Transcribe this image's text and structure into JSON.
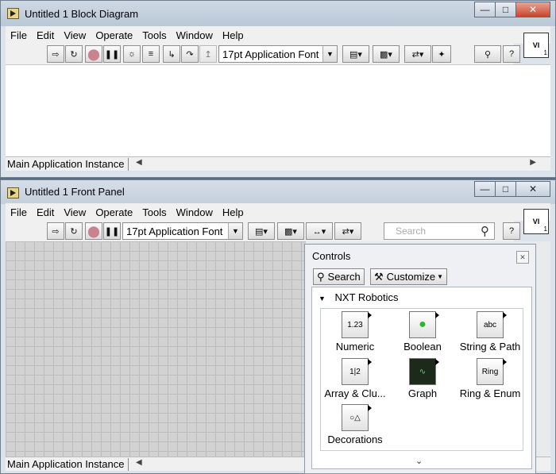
{
  "block_diagram": {
    "title": "Untitled 1 Block Diagram",
    "menu": [
      "File",
      "Edit",
      "View",
      "Operate",
      "Tools",
      "Window",
      "Help"
    ],
    "font": "17pt Application Font",
    "status": "Main Application Instance"
  },
  "front_panel": {
    "title": "Untitled 1 Front Panel",
    "menu": [
      "File",
      "Edit",
      "View",
      "Operate",
      "Tools",
      "Window",
      "Help"
    ],
    "font": "17pt Application Font",
    "search_placeholder": "Search",
    "status": "Main Application Instance"
  },
  "controls_palette": {
    "title": "Controls",
    "search_label": "Search",
    "customize_label": "Customize",
    "category": "NXT Robotics",
    "items": [
      {
        "label": "Numeric",
        "icon": "numeric-icon"
      },
      {
        "label": "Boolean",
        "icon": "boolean-icon"
      },
      {
        "label": "String & Path",
        "icon": "string-path-icon"
      },
      {
        "label": "Array & Clu...",
        "icon": "array-cluster-icon"
      },
      {
        "label": "Graph",
        "icon": "graph-icon"
      },
      {
        "label": "Ring & Enum",
        "icon": "ring-enum-icon"
      },
      {
        "label": "Decorations",
        "icon": "decorations-icon"
      }
    ]
  }
}
